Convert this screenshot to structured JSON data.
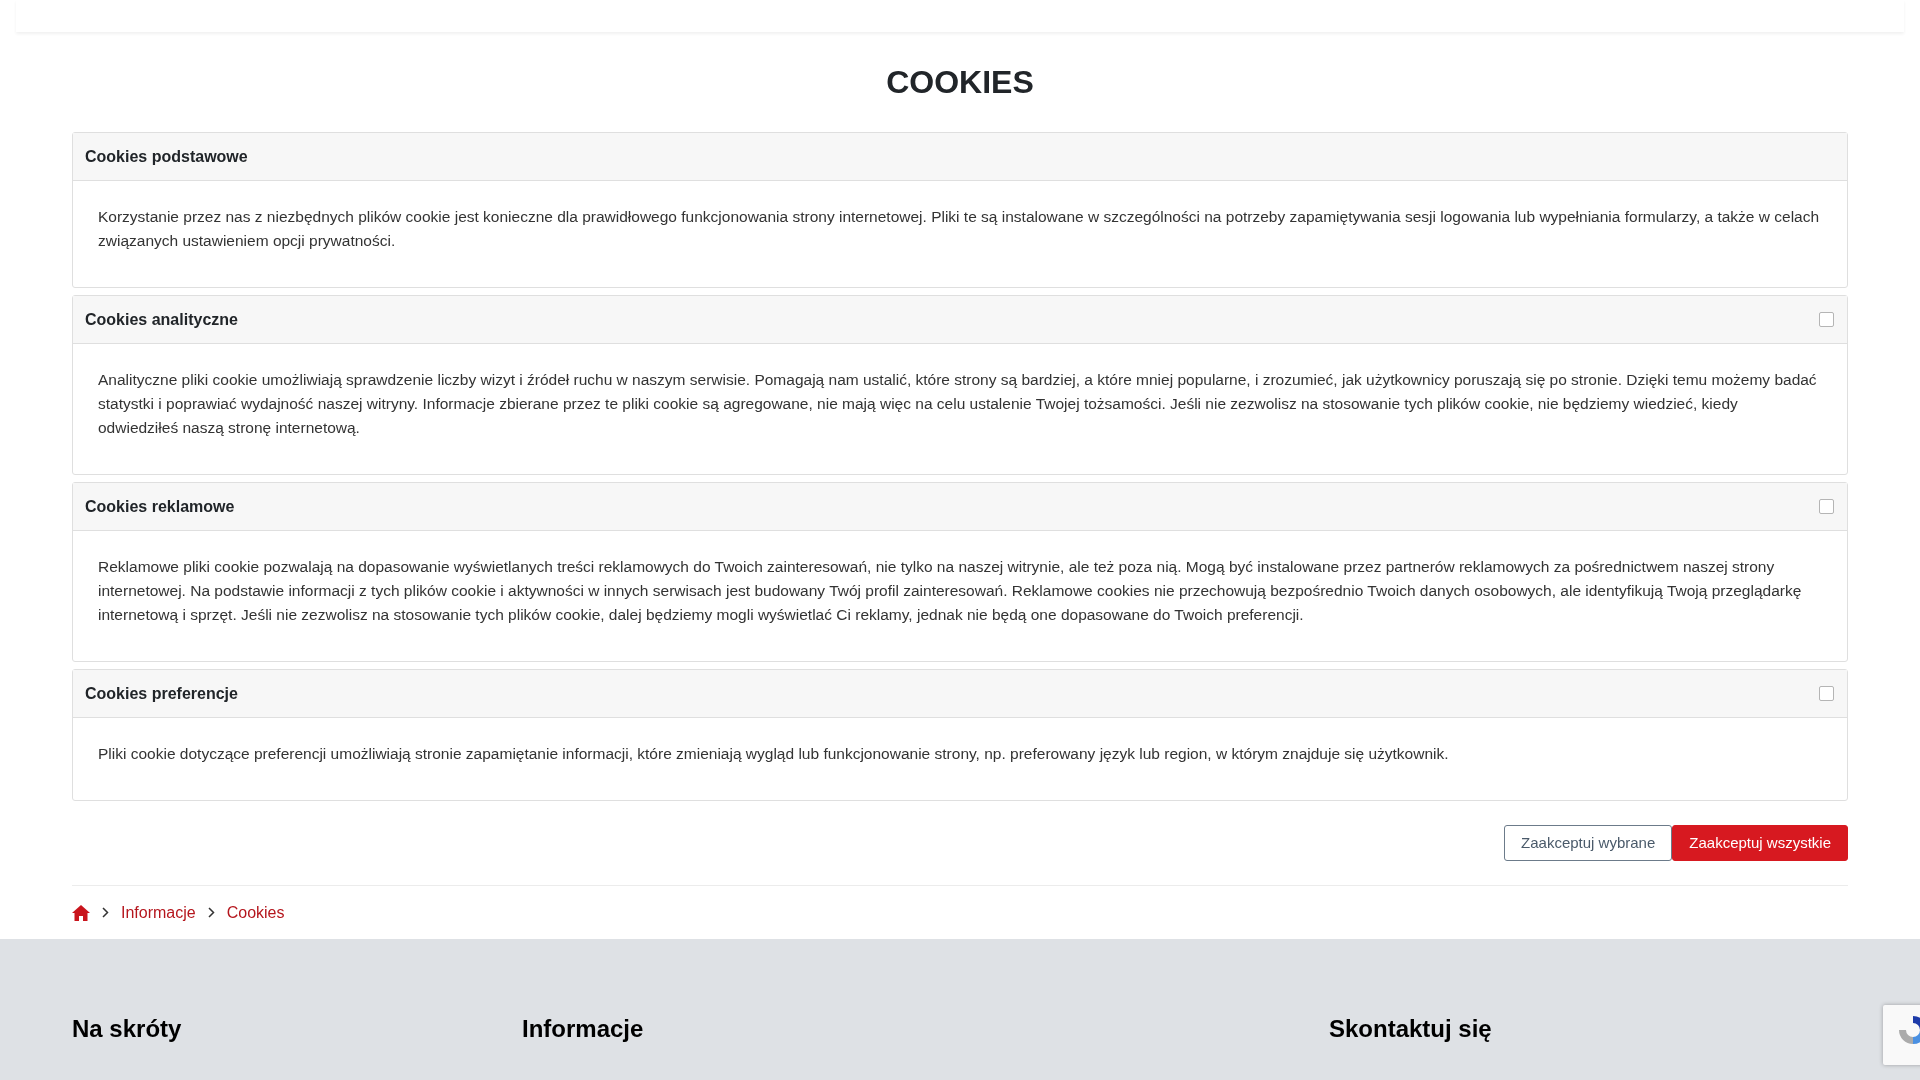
{
  "title": "COOKIES",
  "panels": [
    {
      "heading": "Cookies podstawowe",
      "text": "Korzystanie przez nas z niezbędnych plików cookie jest konieczne dla prawidłowego funkcjonowania strony internetowej. Pliki te są instalowane w szczególności na potrzeby zapamiętywania sesji logowania lub wypełniania formularzy, a także w celach związanych ustawieniem opcji prywatności."
    },
    {
      "heading": "Cookies analityczne",
      "checked": false,
      "text": "Analityczne pliki cookie umożliwiają sprawdzenie liczby wizyt i źródeł ruchu w naszym serwisie. Pomagają nam ustalić, które strony są bardziej, a które mniej popularne, i zrozumieć, jak użytkownicy poruszają się po stronie. Dzięki temu możemy badać statystki i poprawiać wydajność naszej witryny. Informacje zbierane przez te pliki cookie są agregowane, nie mają więc na celu ustalenie Twojej tożsamości. Jeśli nie zezwolisz na stosowanie tych plików cookie, nie będziemy wiedzieć, kiedy odwiedziłeś naszą stronę internetową."
    },
    {
      "heading": "Cookies reklamowe",
      "checked": false,
      "text": "Reklamowe pliki cookie pozwalają na dopasowanie wyświetlanych treści reklamowych do Twoich zainteresowań, nie tylko na naszej witrynie, ale też poza nią. Mogą być instalowane przez partnerów reklamowych za pośrednictwem naszej strony internetowej. Na podstawie informacji z tych plików cookie i aktywności w innych serwisach jest budowany Twój profil zainteresowań. Reklamowe cookies nie przechowują bezpośrednio Twoich danych osobowych, ale identyfikują Twoją przeglądarkę internetową i sprzęt. Jeśli nie zezwolisz na stosowanie tych plików cookie, dalej będziemy mogli wyświetlać Ci reklamy, jednak nie będą one dopasowane do Twoich preferencji."
    },
    {
      "heading": "Cookies preferencje",
      "checked": false,
      "text": "Pliki cookie dotyczące preferencji umożliwiają stronie zapamiętanie informacji, które zmieniają wygląd lub funkcjonowanie strony, np. preferowany język lub region, w którym znajduje się użytkownik."
    }
  ],
  "buttons": [
    {
      "label": "Zaakceptuj wybrane",
      "kind": "outline"
    },
    {
      "label": "Zaakceptuj wszystkie",
      "kind": "primary"
    }
  ],
  "breadcrumb": [
    "Informacje",
    "Cookies"
  ],
  "footer": {
    "headings": [
      "Na skróty",
      "Informacje",
      "Skontaktuj się"
    ]
  }
}
